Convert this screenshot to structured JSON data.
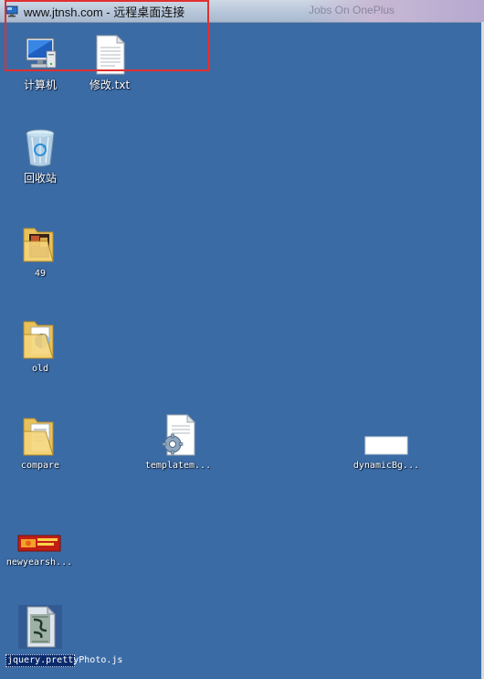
{
  "window": {
    "title": "www.jtnsh.com - 远程桌面连接",
    "background_title": "Jobs On OnePlus"
  },
  "colors": {
    "desktop": "#3b6ba5",
    "highlight": "#e03030"
  },
  "desktop_icons": [
    {
      "id": "computer",
      "label": "计算机",
      "icon": "computer-icon"
    },
    {
      "id": "txt",
      "label": "修改.txt",
      "icon": "text-file-icon"
    },
    {
      "id": "recycle",
      "label": "回收站",
      "icon": "recycle-bin-icon"
    },
    {
      "id": "folder49",
      "label": "49",
      "icon": "folder-icon"
    },
    {
      "id": "old",
      "label": "old",
      "icon": "folder-icon"
    },
    {
      "id": "compare",
      "label": "compare",
      "icon": "folder-icon"
    },
    {
      "id": "templatem",
      "label": "templatem...",
      "icon": "settings-file-icon"
    },
    {
      "id": "dynamicbg",
      "label": "dynamicBg...",
      "icon": "image-file-icon"
    },
    {
      "id": "newyearsh",
      "label": "newyearsh...",
      "icon": "banner-image-icon"
    },
    {
      "id": "jquery",
      "label": "jquery.prettyPhoto.js",
      "icon": "script-file-icon"
    }
  ]
}
